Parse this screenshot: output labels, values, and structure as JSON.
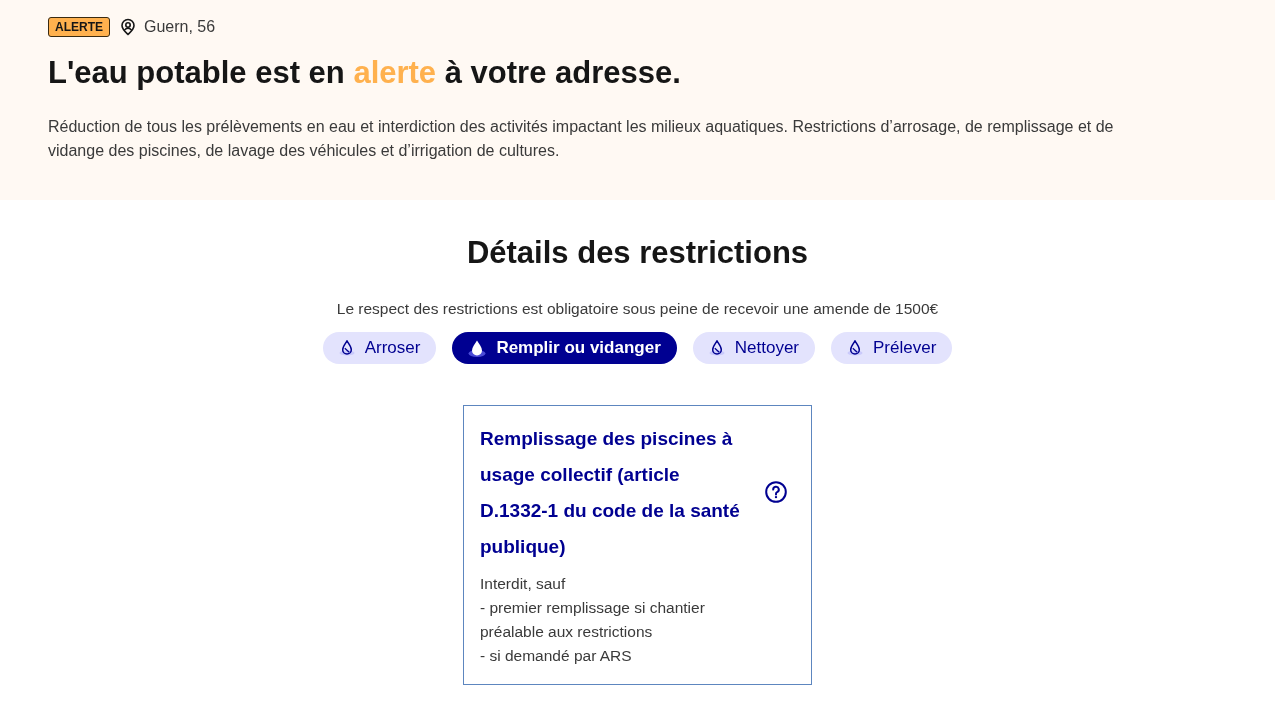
{
  "alert_banner": {
    "badge": "ALERTE",
    "location": "Guern, 56",
    "title": [
      {
        "text": "L'eau potable est en ",
        "highlight": false
      },
      {
        "text": "alerte",
        "highlight": true
      },
      {
        "text": " à votre adresse.",
        "highlight": false
      }
    ],
    "description": "Réduction de tous les prélèvements en eau et interdiction des activités impactant les milieux aquatiques. Restrictions d’arrosage, de remplissage et de vidange des piscines, de lavage des véhicules et d’irrigation de cultures."
  },
  "restrictions": {
    "heading": "Détails des restrictions",
    "notice": "Le respect des restrictions est obligatoire sous peine de recevoir une amende de 1500€",
    "tags": [
      {
        "label": "Arroser",
        "selected": false
      },
      {
        "label": "Remplir ou vidanger",
        "selected": true
      },
      {
        "label": "Nettoyer",
        "selected": false
      },
      {
        "label": "Prélever",
        "selected": false
      }
    ],
    "cards": [
      {
        "title": "Remplissage des piscines à usage collectif (article D.1332-1 du code de la santé publique)",
        "body": "Interdit, sauf\n- premier remplissage si chantier préalable aux restrictions\n- si demandé par ARS"
      }
    ]
  }
}
